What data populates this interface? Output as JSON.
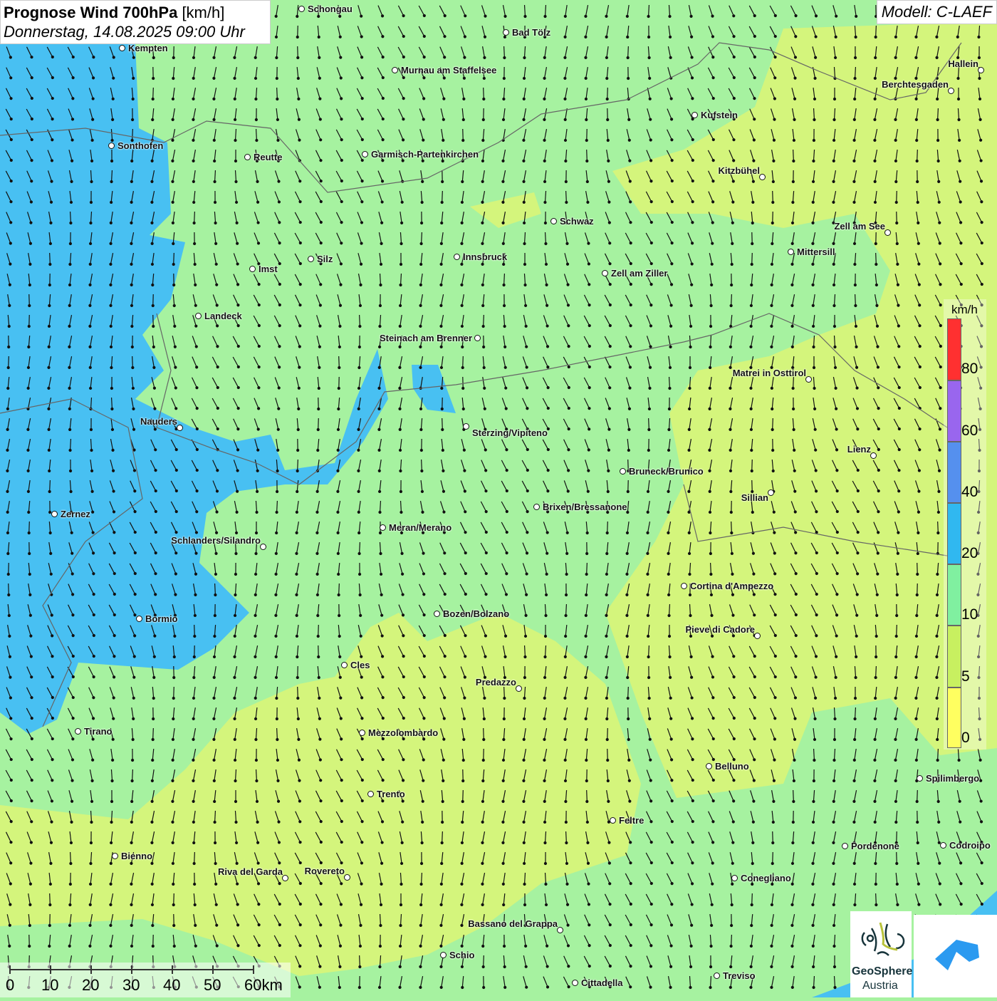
{
  "title": {
    "main": "Prognose Wind 700hPa",
    "unit": "[km/h]",
    "datetime": "Donnerstag, 14.08.2025 09:00 Uhr"
  },
  "model": "Modell: C-LAEF",
  "legend": {
    "unit": "km/h",
    "ticks": [
      "80",
      "60",
      "40",
      "20",
      "10",
      "5",
      "0"
    ],
    "colors": [
      "#ff3030",
      "#9966ee",
      "#5590ee",
      "#30b8f0",
      "#80f0a0",
      "#c8f060",
      "#ffff60"
    ]
  },
  "scale": {
    "labels": [
      "0",
      "10",
      "20",
      "30",
      "40",
      "50",
      "60km"
    ]
  },
  "logos": {
    "geosphere_line1": "GeoSphere",
    "geosphere_line2": "Austria"
  },
  "colors": {
    "background": "#a6f2a0",
    "blue_zone": "#48c0f2",
    "yellow_zone": "#d4f57c"
  },
  "cities": [
    "Schongau",
    "Bad Tölz",
    "Kempten",
    "Murnau am Staffelsee",
    "Hallein",
    "Berchtesgaden",
    "Kufstein",
    "Sonthofen",
    "Reutte",
    "Garmisch-Partenkirchen",
    "Kitzbühel",
    "Schwaz",
    "Zell am See",
    "Innsbruck",
    "Silz",
    "Imst",
    "Mittersill",
    "Zell am Ziller",
    "Landeck",
    "Steinach am Brenner",
    "Matrei in Osttirol",
    "Nauders",
    "Sterzing/Vipiteno",
    "Lienz",
    "Bruneck/Brunico",
    "Sillian",
    "Brixen/Bressanone",
    "Zernez",
    "Meran/Merano",
    "Schlanders/Silandro",
    "Cortina d'Ampezzo",
    "Bozen/Bolzano",
    "Bormio",
    "Pieve di Cadore",
    "Cles",
    "Predazzo",
    "Tirano",
    "Mezzolombardo",
    "Belluno",
    "Spilimbergo",
    "Trento",
    "Feltre",
    "Pordenone",
    "Codroipo",
    "Bienno",
    "Riva del Garda",
    "Rovereto",
    "Conegliano",
    "Bassano del Grappa",
    "Schio",
    "Treviso",
    "Cittadella"
  ]
}
